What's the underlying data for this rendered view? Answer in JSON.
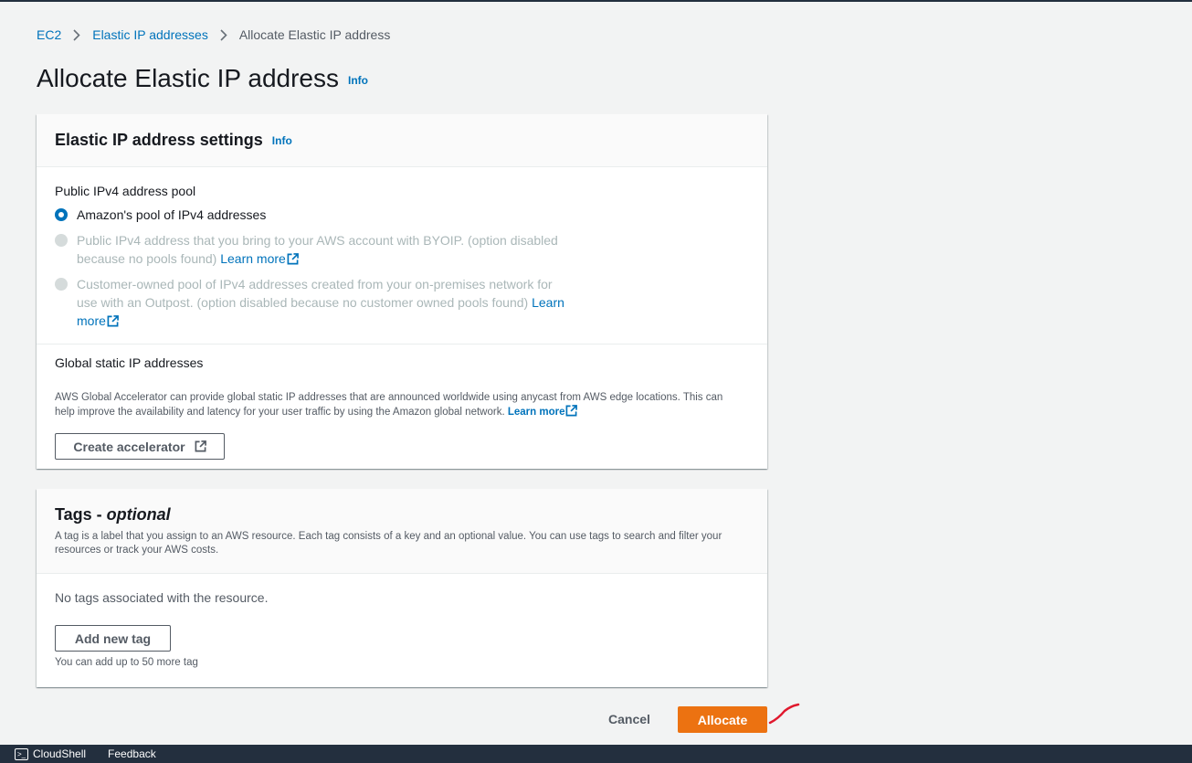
{
  "breadcrumb": {
    "items": [
      "EC2",
      "Elastic IP addresses"
    ],
    "current": "Allocate Elastic IP address"
  },
  "page": {
    "title": "Allocate Elastic IP address",
    "info": "Info"
  },
  "settings": {
    "title": "Elastic IP address settings",
    "info": "Info",
    "pool_label": "Public IPv4 address pool",
    "options": [
      {
        "text": "Amazon's pool of IPv4 addresses",
        "selected": true,
        "disabled": false
      },
      {
        "text": "Public IPv4 address that you bring to your AWS account with BYOIP. (option disabled because no pools found)",
        "link": "Learn more",
        "selected": false,
        "disabled": true
      },
      {
        "text": "Customer-owned pool of IPv4 addresses created from your on-premises network for use with an Outpost. (option disabled because no customer owned pools found)",
        "link": "Learn more",
        "selected": false,
        "disabled": true
      }
    ],
    "global_label": "Global static IP addresses",
    "global_desc": "AWS Global Accelerator can provide global static IP addresses that are announced worldwide using anycast from AWS edge locations. This can help improve the availability and latency for your user traffic by using the Amazon global network.",
    "global_link": "Learn more",
    "create_accelerator": "Create accelerator"
  },
  "tags": {
    "title": "Tags - ",
    "title_optional": "optional",
    "description": "A tag is a label that you assign to an AWS resource. Each tag consists of a key and an optional value. You can use tags to search and filter your resources or track your AWS costs.",
    "empty": "No tags associated with the resource.",
    "add_button": "Add new tag",
    "hint": "You can add up to 50 more tag"
  },
  "actions": {
    "cancel": "Cancel",
    "allocate": "Allocate"
  },
  "footer": {
    "cloudshell": "CloudShell",
    "feedback": "Feedback"
  },
  "colors": {
    "link": "#0073bb",
    "primary": "#ec7211",
    "footer_bg": "#232f3e",
    "pen_mark": "#e0182d"
  }
}
